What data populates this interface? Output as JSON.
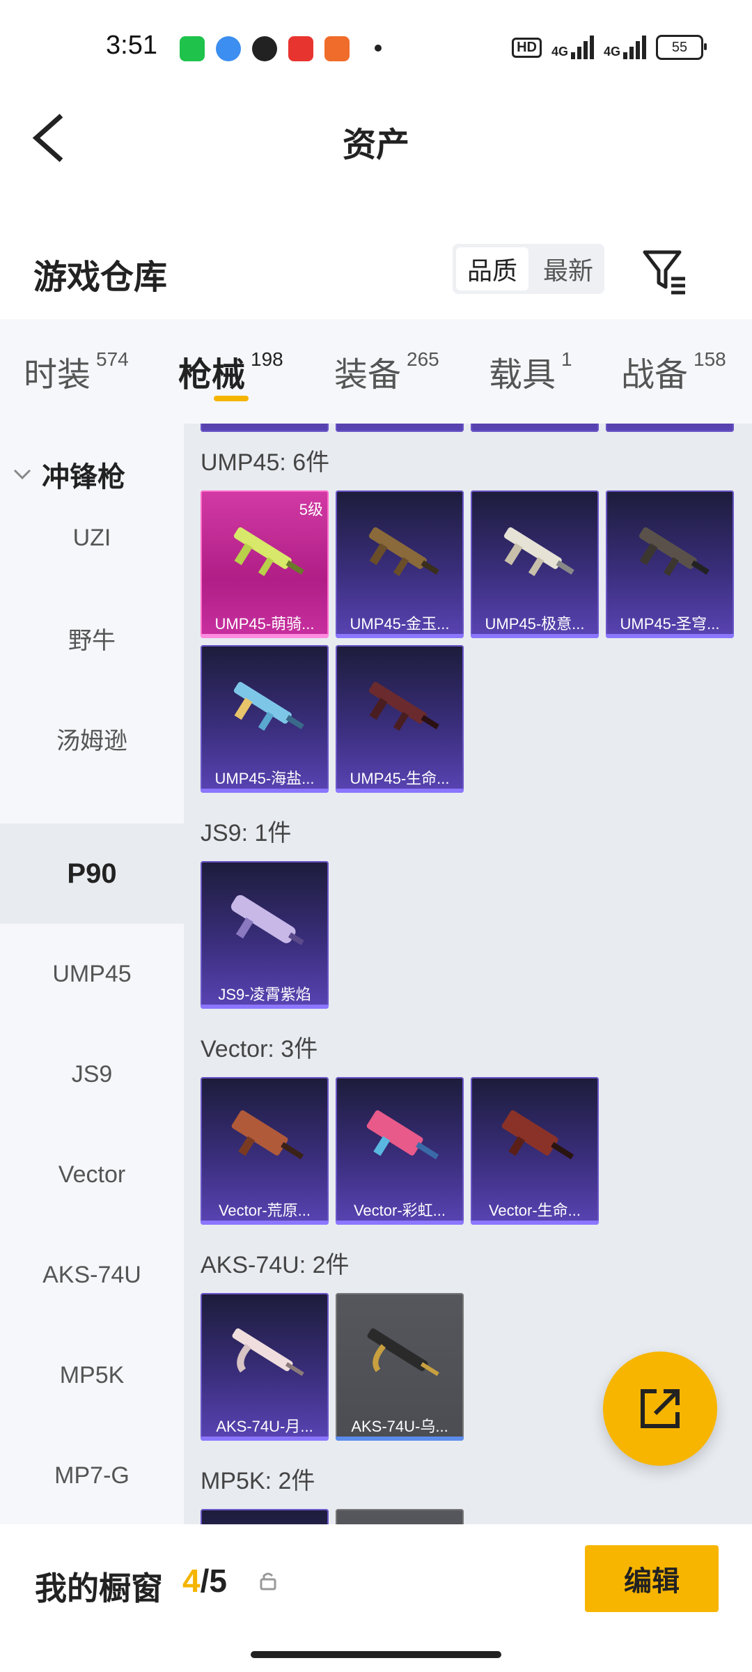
{
  "status": {
    "time": "3:51",
    "hd": "HD",
    "net1": "4G",
    "net2": "4G",
    "battery": "55"
  },
  "header": {
    "title": "资产"
  },
  "section": {
    "title": "游戏仓库",
    "sort_options": [
      "品质",
      "最新"
    ],
    "active_sort": "品质"
  },
  "tabs": [
    {
      "label": "时装",
      "count": "574"
    },
    {
      "label": "枪械",
      "count": "198"
    },
    {
      "label": "装备",
      "count": "265"
    },
    {
      "label": "载具",
      "count": "1"
    },
    {
      "label": "战备",
      "count": "158"
    }
  ],
  "active_tab": "枪械",
  "sidebar": {
    "category": "冲锋枪",
    "items": [
      "UZI",
      "野牛",
      "汤姆逊",
      "P90",
      "UMP45",
      "JS9",
      "Vector",
      "AKS-74U",
      "MP5K",
      "MP7-G"
    ],
    "active": "P90"
  },
  "groups": [
    {
      "label": "UMP45: 6件",
      "items": [
        {
          "name": "UMP45-萌骑...",
          "level": "5级",
          "tier": "pink"
        },
        {
          "name": "UMP45-金玉...",
          "tier": "purple"
        },
        {
          "name": "UMP45-极意...",
          "tier": "purple"
        },
        {
          "name": "UMP45-圣穹...",
          "tier": "purple"
        },
        {
          "name": "UMP45-海盐...",
          "tier": "purple"
        },
        {
          "name": "UMP45-生命...",
          "tier": "purple"
        }
      ]
    },
    {
      "label": "JS9: 1件",
      "items": [
        {
          "name": "JS9-凌霄紫焰",
          "tier": "purple"
        }
      ]
    },
    {
      "label": "Vector: 3件",
      "items": [
        {
          "name": "Vector-荒原...",
          "tier": "purple"
        },
        {
          "name": "Vector-彩虹...",
          "tier": "purple"
        },
        {
          "name": "Vector-生命...",
          "tier": "purple"
        }
      ]
    },
    {
      "label": "AKS-74U: 2件",
      "items": [
        {
          "name": "AKS-74U-月...",
          "tier": "purple"
        },
        {
          "name": "AKS-74U-乌...",
          "tier": "grey"
        }
      ]
    },
    {
      "label": "MP5K: 2件",
      "items": []
    }
  ],
  "showcase": {
    "title": "我的橱窗",
    "current": "4",
    "total": "5",
    "edit_label": "编辑"
  },
  "colors": {
    "accent": "#f7b500",
    "purple_tier": "#5a44b4",
    "pink_tier": "#d23aa4"
  }
}
